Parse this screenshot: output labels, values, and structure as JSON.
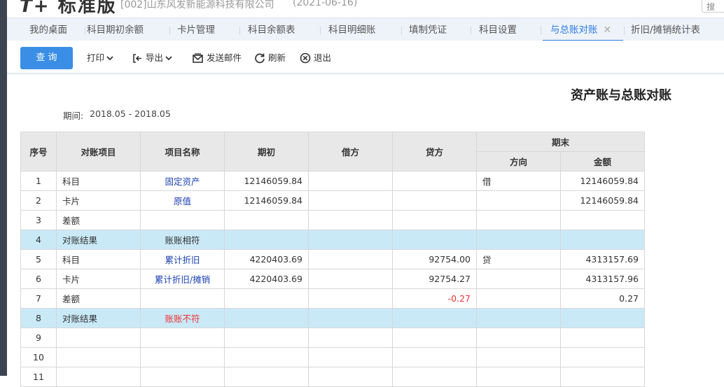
{
  "header": {
    "brand": "标准版",
    "company": "[002]山东风发新能源科技有限公司",
    "date": "(2021-06-16)",
    "search_label": "搜"
  },
  "tabs": [
    {
      "label": "我的桌面"
    },
    {
      "label": "科目期初余额"
    },
    {
      "label": "卡片管理"
    },
    {
      "label": "科目余额表"
    },
    {
      "label": "科目明细账"
    },
    {
      "label": "填制凭证"
    },
    {
      "label": "科目设置"
    },
    {
      "label": "与总账对账",
      "active": true
    },
    {
      "label": "折旧/摊销统计表"
    }
  ],
  "toolbar": {
    "query": "查 询",
    "print": "打印",
    "export": "导出",
    "email": "发送邮件",
    "refresh": "刷新",
    "exit": "退出"
  },
  "report": {
    "title": "资产账与总账对账",
    "period_label": "期间:",
    "period_value": "2018.05 - 2018.05",
    "columns": {
      "seq": "序号",
      "item": "对账项目",
      "name": "项目名称",
      "opening": "期初",
      "debit": "借方",
      "credit": "贷方",
      "end": "期末",
      "direction": "方向",
      "amount": "金额"
    },
    "rows": [
      {
        "seq": "1",
        "item": "科目",
        "name": "固定资产",
        "opening": "12146059.84",
        "debit": "",
        "credit": "",
        "direction": "借",
        "amount": "12146059.84"
      },
      {
        "seq": "2",
        "item": "卡片",
        "name": "原值",
        "opening": "12146059.84",
        "debit": "",
        "credit": "",
        "direction": "",
        "amount": "12146059.84"
      },
      {
        "seq": "3",
        "item": "差额",
        "name": "",
        "opening": "",
        "debit": "",
        "credit": "",
        "direction": "",
        "amount": ""
      },
      {
        "seq": "4",
        "item": "对账结果",
        "name": "账账相符",
        "opening": "",
        "debit": "",
        "credit": "",
        "direction": "",
        "amount": ""
      },
      {
        "seq": "5",
        "item": "科目",
        "name": "累计折旧",
        "opening": "4220403.69",
        "debit": "",
        "credit": "92754.00",
        "direction": "贷",
        "amount": "4313157.69"
      },
      {
        "seq": "6",
        "item": "卡片",
        "name": "累计折旧/摊销",
        "opening": "4220403.69",
        "debit": "",
        "credit": "92754.27",
        "direction": "",
        "amount": "4313157.96"
      },
      {
        "seq": "7",
        "item": "差额",
        "name": "",
        "opening": "",
        "debit": "",
        "credit": "-0.27",
        "direction": "",
        "amount": "0.27"
      },
      {
        "seq": "8",
        "item": "对账结果",
        "name": "账账不符",
        "opening": "",
        "debit": "",
        "credit": "",
        "direction": "",
        "amount": ""
      },
      {
        "seq": "9",
        "item": "",
        "name": "",
        "opening": "",
        "debit": "",
        "credit": "",
        "direction": "",
        "amount": ""
      },
      {
        "seq": "10",
        "item": "",
        "name": "",
        "opening": "",
        "debit": "",
        "credit": "",
        "direction": "",
        "amount": ""
      },
      {
        "seq": "11",
        "item": "",
        "name": "",
        "opening": "",
        "debit": "",
        "credit": "",
        "direction": "",
        "amount": ""
      }
    ]
  }
}
